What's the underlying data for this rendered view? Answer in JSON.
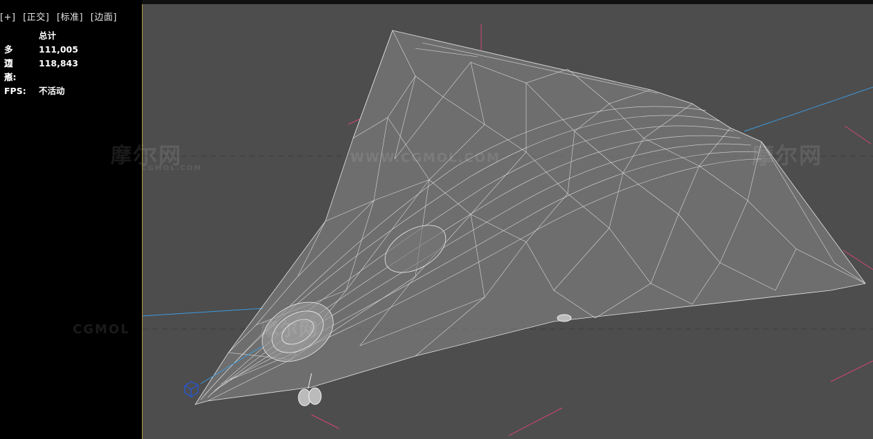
{
  "viewport_labels": [
    "[+]",
    "[正交]",
    "[标准]",
    "[边面]"
  ],
  "stats": {
    "header": "总计",
    "polygons_label": "多边形:",
    "polygons_value": "111,005",
    "vertices_label": "顶点:",
    "vertices_value": "118,843",
    "fps_label": "FPS:",
    "fps_value": "不活动"
  },
  "watermark": {
    "logo_text": "摩尔网",
    "url_text": "WWW.CGMOL.COM",
    "brand_text": "CGMOL"
  },
  "colors": {
    "viewport_bg": "#4d4d4d",
    "panel_bg": "#000000",
    "wire": "#e8e8e8",
    "axis_blue": "#3c9be0",
    "axis_pink": "#d0457a",
    "active_border": "#b89a3c"
  }
}
